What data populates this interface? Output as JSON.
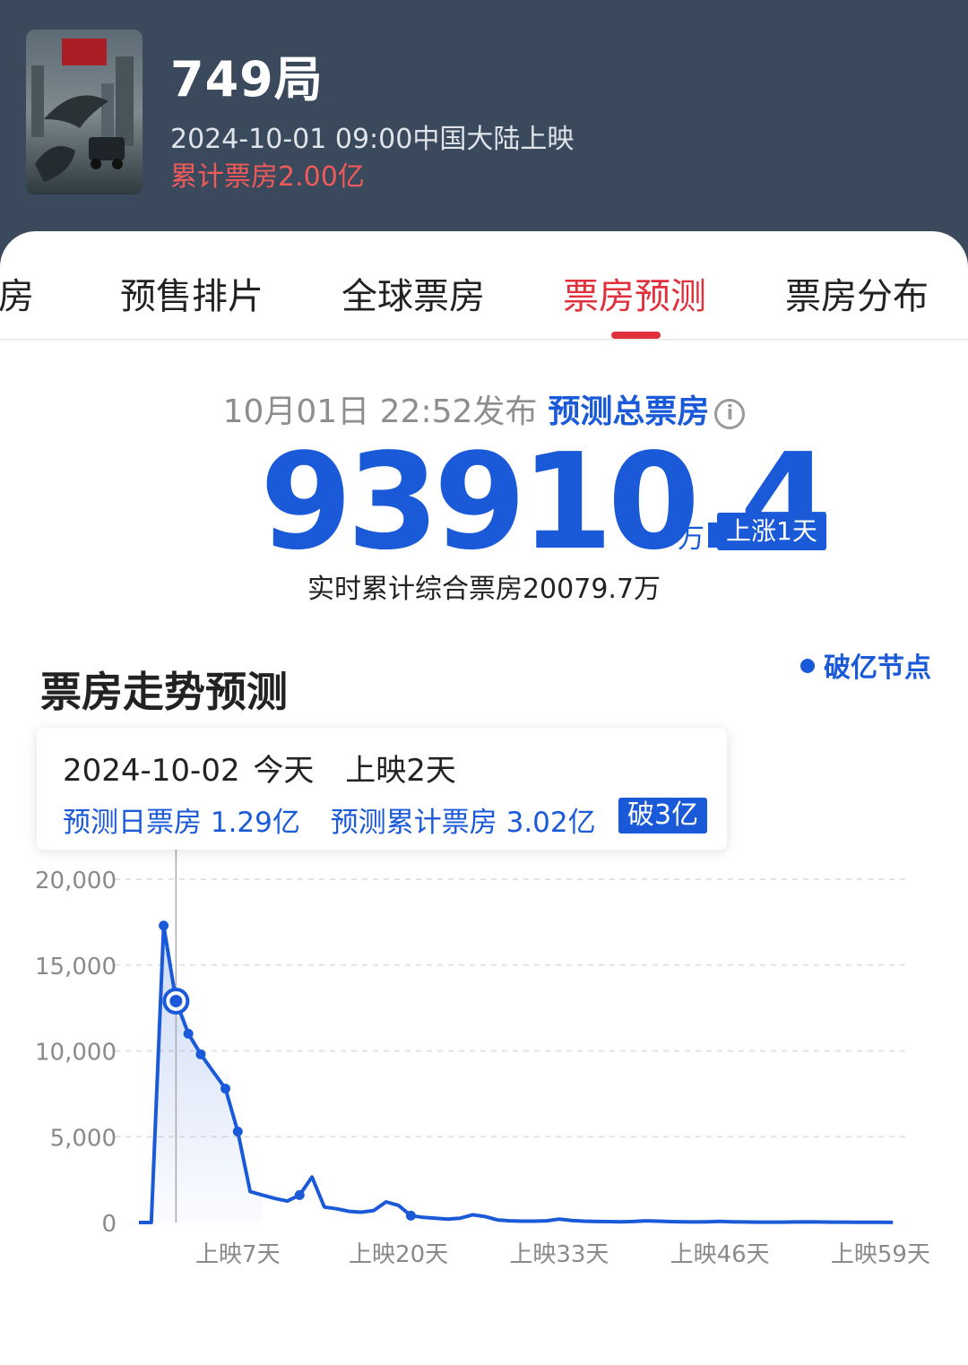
{
  "movie": {
    "title": "749局",
    "release": "2024-10-01 09:00中国大陆上映",
    "cumulative": "累计票房2.00亿"
  },
  "tabs": [
    {
      "label": "票房"
    },
    {
      "label": "预售排片"
    },
    {
      "label": "全球票房"
    },
    {
      "label": "票房预测",
      "active": true
    },
    {
      "label": "票房分布"
    }
  ],
  "forecast": {
    "publish_time": "10月01日 22:52发布",
    "label": "预测总票房",
    "total": "93910.4",
    "unit": "万",
    "change": "上涨1天",
    "realtime": "实时累计综合票房20079.7万"
  },
  "trend": {
    "title": "票房走势预测",
    "legend": "破亿节点"
  },
  "tooltip": {
    "date": "2024-10-02",
    "today": "今天",
    "days": "上映2天",
    "daily": "预测日票房 1.29亿",
    "cumulative": "预测累计票房 3.02亿",
    "badge": "破3亿"
  },
  "colors": {
    "accent": "#1a5ad8",
    "tab_active": "#e0313d",
    "header_bg": "#3a4a5c",
    "cumulative_text": "#f05a5a"
  },
  "chart_data": {
    "type": "line",
    "ylabel_ticks": [
      "20,000",
      "15,000",
      "10,000",
      "5,000",
      "0"
    ],
    "ylim": [
      0,
      20000
    ],
    "xlim": [
      -1,
      61
    ],
    "x_ticks": [
      {
        "day": 7,
        "label": "上映7天"
      },
      {
        "day": 20,
        "label": "上映20天"
      },
      {
        "day": 33,
        "label": "上映33天"
      },
      {
        "day": 46,
        "label": "上映46天"
      },
      {
        "day": 59,
        "label": "上映59天"
      }
    ],
    "grid": true,
    "highlight_day": 2,
    "series": [
      {
        "x": [
          -1,
          0,
          1,
          2,
          3,
          4,
          5,
          6,
          7,
          8,
          9,
          10,
          11,
          12,
          13,
          14,
          15,
          16,
          17,
          18,
          19,
          20,
          21,
          22,
          23,
          24,
          25,
          26,
          27,
          28,
          29,
          30,
          31,
          32,
          33,
          34,
          35,
          36,
          37,
          38,
          39,
          40,
          41,
          42,
          43,
          44,
          45,
          46,
          47,
          48,
          49,
          50,
          51,
          52,
          53,
          54,
          55,
          56,
          57,
          58,
          59,
          60
        ],
        "values": [
          0,
          0,
          17300,
          12900,
          11000,
          9800,
          8800,
          7800,
          5300,
          1800,
          1600,
          1400,
          1250,
          1600,
          2650,
          900,
          800,
          650,
          600,
          700,
          1200,
          1000,
          400,
          300,
          250,
          200,
          250,
          450,
          350,
          150,
          100,
          80,
          80,
          100,
          200,
          120,
          80,
          60,
          50,
          40,
          60,
          100,
          80,
          50,
          40,
          30,
          40,
          70,
          40,
          30,
          20,
          20,
          20,
          30,
          40,
          30,
          20,
          20,
          15,
          10,
          10,
          5
        ],
        "markers": [
          1,
          2,
          3,
          4,
          6,
          7,
          12,
          21
        ]
      }
    ]
  }
}
